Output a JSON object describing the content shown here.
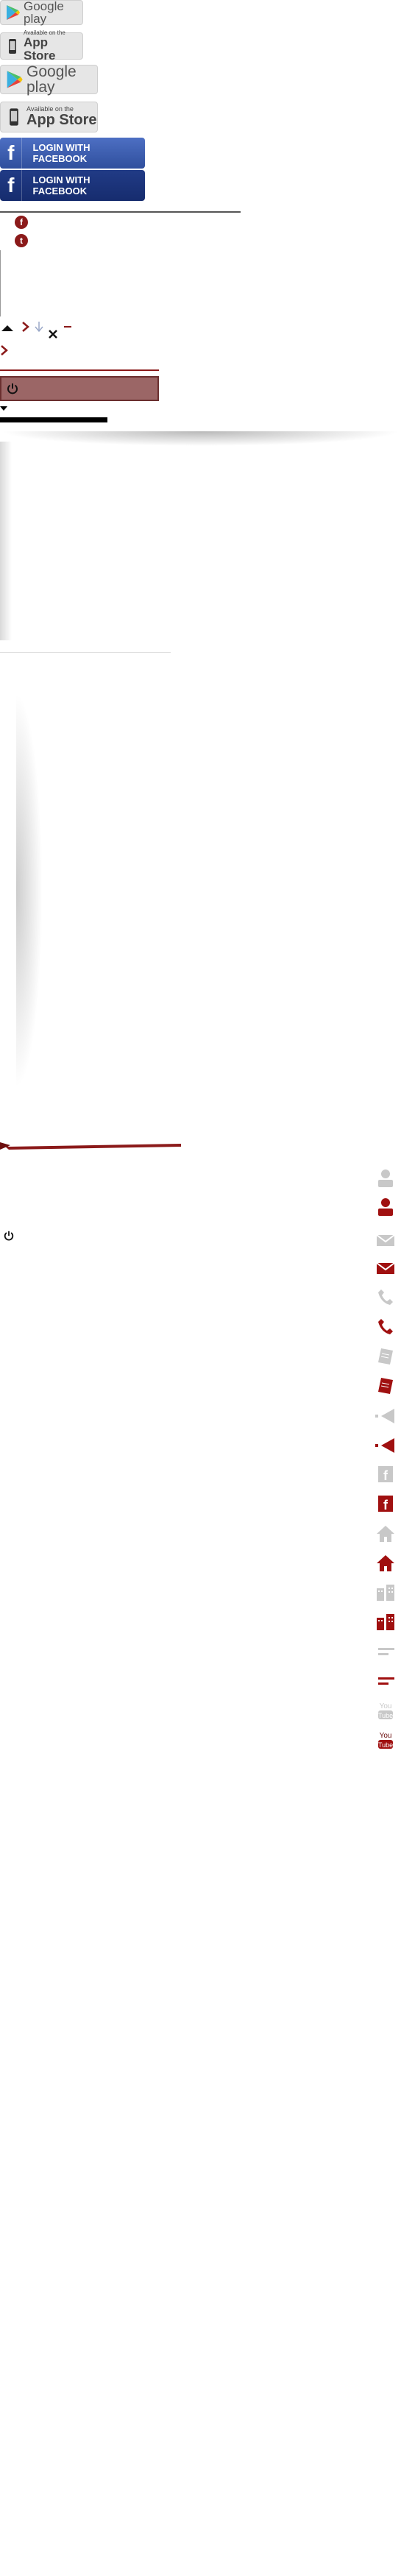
{
  "badges": {
    "google_play": "Google play",
    "app_store_top": "Available on the",
    "app_store_bottom": "App Store"
  },
  "facebook": {
    "login_label": "LOGIN WITH FACEBOOK"
  },
  "social": {
    "facebook_letter": "f",
    "twitter_letter": "t"
  },
  "sidebar_icons": [
    "user-icon-grey",
    "user-icon-red",
    "mail-icon-grey",
    "mail-icon-red",
    "phone-icon-grey",
    "phone-icon-red",
    "document-icon-grey",
    "document-icon-red",
    "arrow-left-icon-grey",
    "arrow-left-icon-red",
    "facebook-icon-grey",
    "facebook-icon-red",
    "home-icon-grey",
    "home-icon-red",
    "building-icon-grey",
    "building-icon-red",
    "menu-lines-icon-grey",
    "menu-lines-icon-red",
    "youtube-icon-grey",
    "youtube-icon-red"
  ],
  "youtube": {
    "you": "You",
    "tube": "Tube"
  },
  "colors": {
    "accent": "#8b1a1a",
    "grey": "#c8c8c8",
    "facebook_blue": "#3b5998"
  }
}
